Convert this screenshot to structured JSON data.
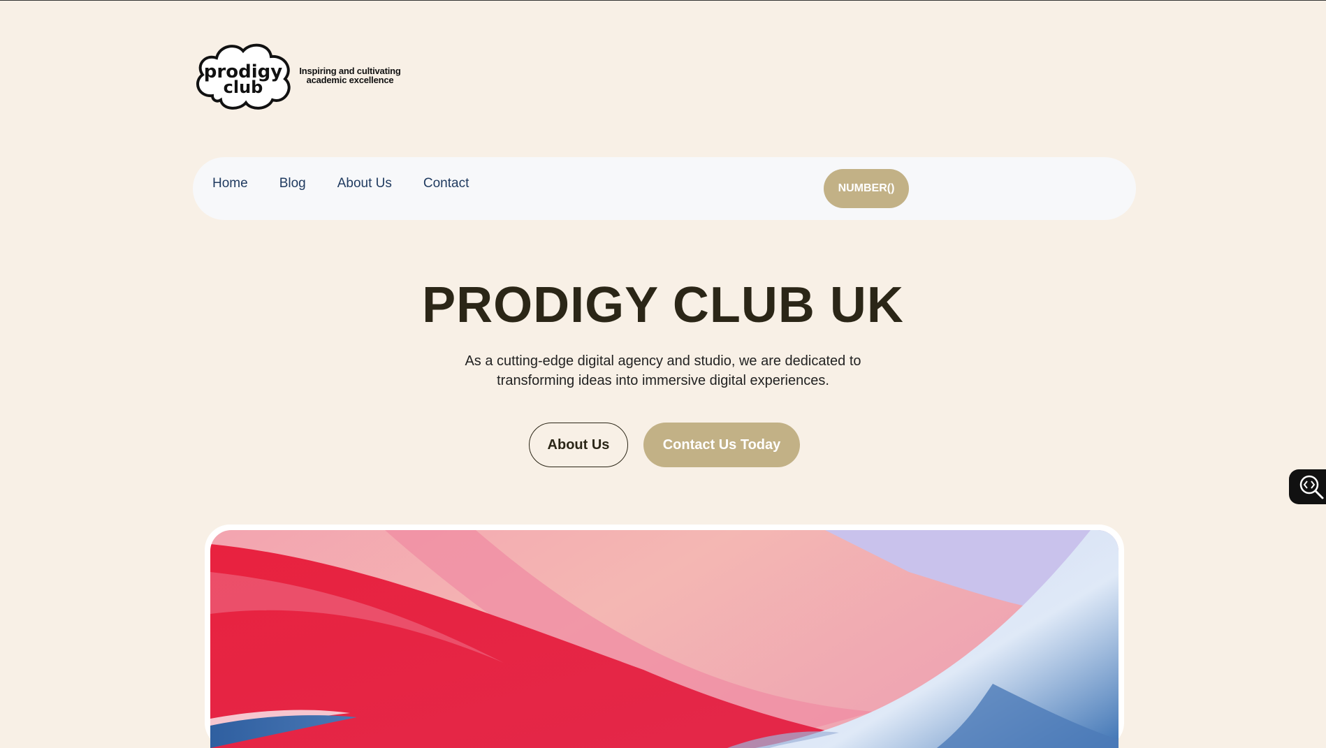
{
  "brand": {
    "logo_text_line1": "prodigy",
    "logo_text_line2": "club",
    "tagline_line1": "Inspiring and cultivating",
    "tagline_line2": "academic excellence"
  },
  "nav": {
    "items": [
      {
        "label": "Home"
      },
      {
        "label": "Blog"
      },
      {
        "label": "About Us"
      },
      {
        "label": "Contact"
      }
    ],
    "number_button_label": "NUMBER()"
  },
  "hero": {
    "title": "PRODIGY CLUB UK",
    "subtitle_line1": "As a cutting-edge digital agency and studio, we are dedicated to",
    "subtitle_line2": "transforming ideas into immersive digital experiences.",
    "about_button_label": "About Us",
    "contact_button_label": "Contact Us Today"
  },
  "side_widget": {
    "icon": "code-search-icon"
  },
  "colors": {
    "background": "#f8f0e6",
    "accent": "#c2b186",
    "heading": "#2b2617",
    "nav_text": "#1f3a5f"
  }
}
